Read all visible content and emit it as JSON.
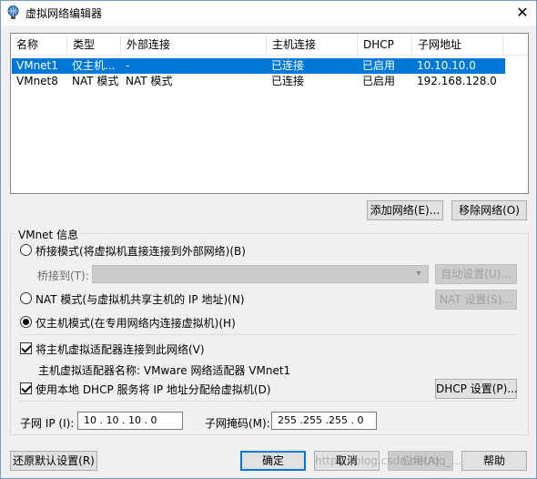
{
  "window": {
    "title": "虚拟网络编辑器",
    "close_glyph": "✕"
  },
  "table": {
    "columns": [
      "名称",
      "类型",
      "外部连接",
      "主机连接",
      "DHCP",
      "子网地址"
    ],
    "rows": [
      [
        "VMnet1",
        "仅主机...",
        "-",
        "已连接",
        "已启用",
        "10.10.10.0"
      ],
      [
        "VMnet8",
        "NAT 模式",
        "NAT 模式",
        "已连接",
        "已启用",
        "192.168.128.0"
      ]
    ],
    "selected_row": 0
  },
  "buttons": {
    "add_network": "添加网络(E)...",
    "remove_network": "移除网络(O)",
    "auto_settings": "自动设置(U)...",
    "nat_settings": "NAT 设置(S)...",
    "dhcp_settings": "DHCP 设置(P)...",
    "restore_defaults": "还原默认设置(R)",
    "ok": "确定",
    "cancel": "取消",
    "apply": "应用(A)",
    "help": "帮助"
  },
  "vmnet_info": {
    "group_label": "VMnet 信息",
    "bridged_label": "桥接模式(将虚拟机直接连接到外部网络)(B)",
    "bridged_to_label": "桥接到(T):",
    "nat_label": "NAT 模式(与虚拟机共享主机的 IP 地址)(N)",
    "host_only_label": "仅主机模式(在专用网络内连接虚拟机)(H)",
    "selected_mode": "host_only",
    "connect_adapter_label": "将主机虚拟适配器连接到此网络(V)",
    "connect_adapter_checked": true,
    "adapter_name_text": "主机虚拟适配器名称: VMware 网络适配器 VMnet1",
    "use_dhcp_label": "使用本地 DHCP 服务将 IP 地址分配给虚拟机(D)",
    "use_dhcp_checked": true,
    "subnet_ip_label": "子网 IP (I):",
    "subnet_ip_value": "10 . 10 . 10 . 0",
    "subnet_mask_label": "子网掩码(M):",
    "subnet_mask_value": "255 .255 .255 . 0"
  },
  "watermark": "https://blog.csdn.net/qq_...",
  "colors": {
    "selection": "#0078d7",
    "window_bg": "#f0f0f0"
  }
}
